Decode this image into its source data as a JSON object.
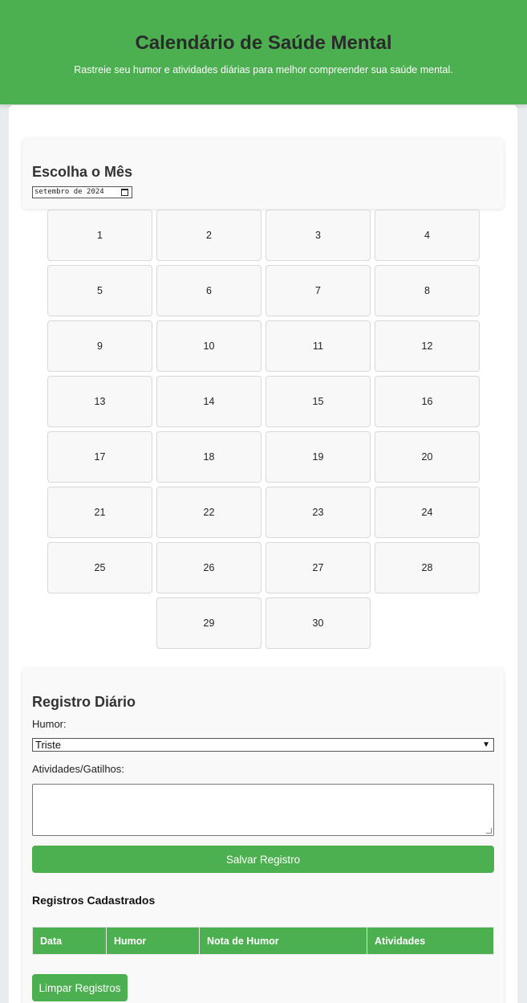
{
  "header": {
    "title": "Calendário de Saúde Mental",
    "subtitle": "Rastreie seu humor e atividades diárias para melhor compreender sua saúde mental."
  },
  "month_picker": {
    "heading": "Escolha o Mês",
    "value": "setembro de 2024",
    "icon": "calendar-icon"
  },
  "calendar": {
    "days": [
      "1",
      "2",
      "3",
      "4",
      "5",
      "6",
      "7",
      "8",
      "9",
      "10",
      "11",
      "12",
      "13",
      "14",
      "15",
      "16",
      "17",
      "18",
      "19",
      "20",
      "21",
      "22",
      "23",
      "24",
      "25",
      "26",
      "27",
      "28",
      "29",
      "30"
    ]
  },
  "daily_entry": {
    "heading": "Registro Diário",
    "mood_label": "Humor:",
    "mood_value": "Triste",
    "activities_label": "Atividades/Gatilhos:",
    "activities_value": "",
    "save_label": "Salvar Registro"
  },
  "records": {
    "heading": "Registros Cadastrados",
    "columns": [
      "Data",
      "Humor",
      "Nota de Humor",
      "Atividades"
    ],
    "rows": [],
    "clear_label": "Limpar Registros"
  },
  "colors": {
    "accent": "#4caf50",
    "background": "#e9ecef",
    "panel": "#f9f9f9"
  }
}
